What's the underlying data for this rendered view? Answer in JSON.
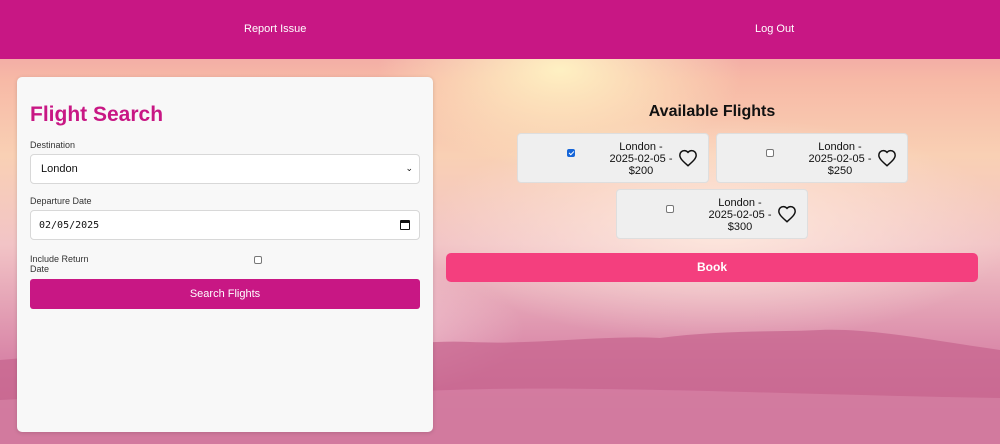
{
  "nav": {
    "report_issue": "Report Issue",
    "log_out": "Log Out"
  },
  "search_form": {
    "title": "Flight Search",
    "destination_label": "Destination",
    "destination_value": "London",
    "departure_label": "Departure Date",
    "departure_value": "02/05/2025",
    "return_label_line1": "Include Return",
    "return_label_line2": "Date",
    "return_checked": false,
    "search_button": "Search Flights"
  },
  "results": {
    "title": "Available Flights",
    "flights": [
      {
        "line1": "London -",
        "line2": "2025-02-05 -",
        "line3": "$200",
        "selected": true,
        "favorite_icon": "heart-outline"
      },
      {
        "line1": "London -",
        "line2": "2025-02-05 -",
        "line3": "$250",
        "selected": false,
        "favorite_icon": "heart-outline"
      },
      {
        "line1": "London -",
        "line2": "2025-02-05 -",
        "line3": "$300",
        "selected": false,
        "favorite_icon": "heart-outline"
      }
    ],
    "book_button": "Book"
  },
  "colors": {
    "primary": "#c81784",
    "book": "#f43f7e",
    "checkbox_checked": "#1565d8"
  }
}
